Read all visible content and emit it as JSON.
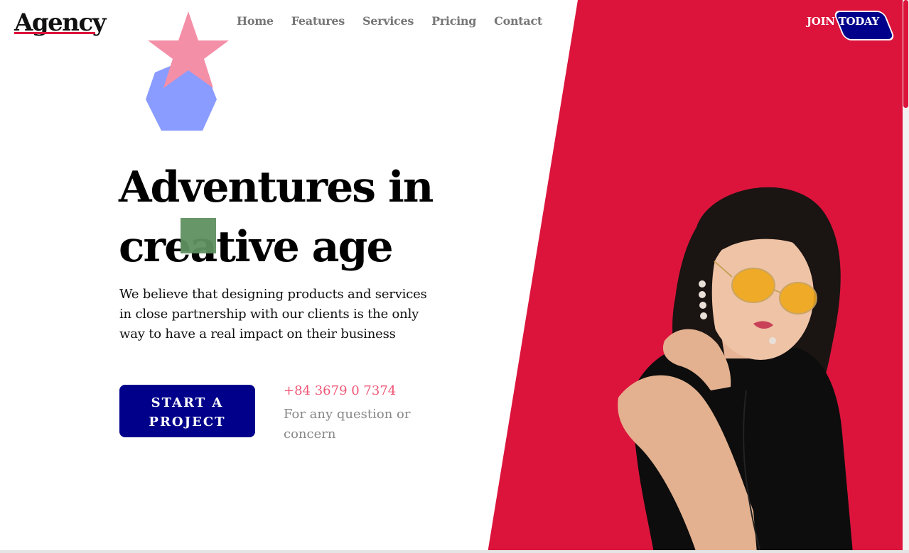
{
  "brand": {
    "logo": "Agency"
  },
  "nav": {
    "items": [
      {
        "label": "Home"
      },
      {
        "label": "Features"
      },
      {
        "label": "Services"
      },
      {
        "label": "Pricing"
      },
      {
        "label": "Contact"
      }
    ]
  },
  "header": {
    "join_label": "JOIN TODAY"
  },
  "hero": {
    "headline_line1": "Adventures in",
    "headline_line2": "creative age",
    "description": "We believe that designing products and services in close partnership with our clients is the only way to have a real impact on their business",
    "cta_label": "START A PROJECT",
    "phone": "+84 3679 0 7374",
    "phone_note": "For any question or concern"
  },
  "colors": {
    "accent": "#dc143c",
    "primary_button": "#00008b",
    "phone_text": "#ef5777",
    "star": "#f48fa8",
    "heptagon": "#8a9cff",
    "square": "#5f9160"
  }
}
